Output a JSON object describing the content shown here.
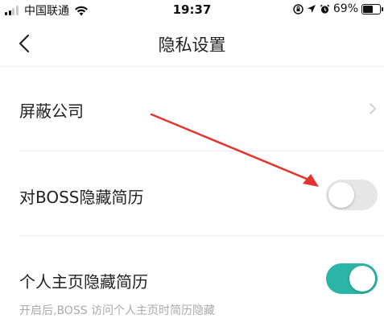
{
  "status_bar": {
    "carrier": "中国联通",
    "time": "19:37",
    "battery_percent": "69%",
    "battery_level": 0.69
  },
  "nav": {
    "title": "隐私设置",
    "back_icon": "chevron-left-icon"
  },
  "settings": {
    "block_company": {
      "label": "屏蔽公司"
    },
    "hide_resume_from_boss": {
      "label": "对BOSS隐藏简历",
      "enabled": false
    },
    "hide_resume_on_profile": {
      "label": "个人主页隐藏简历",
      "enabled": true,
      "hint": "开启后,BOSS 访问个人主页时简历隐藏"
    }
  },
  "colors": {
    "toggle_on": "#2bb5a6",
    "toggle_off": "#e6e6e6",
    "annotation_arrow": "#e3342f"
  }
}
